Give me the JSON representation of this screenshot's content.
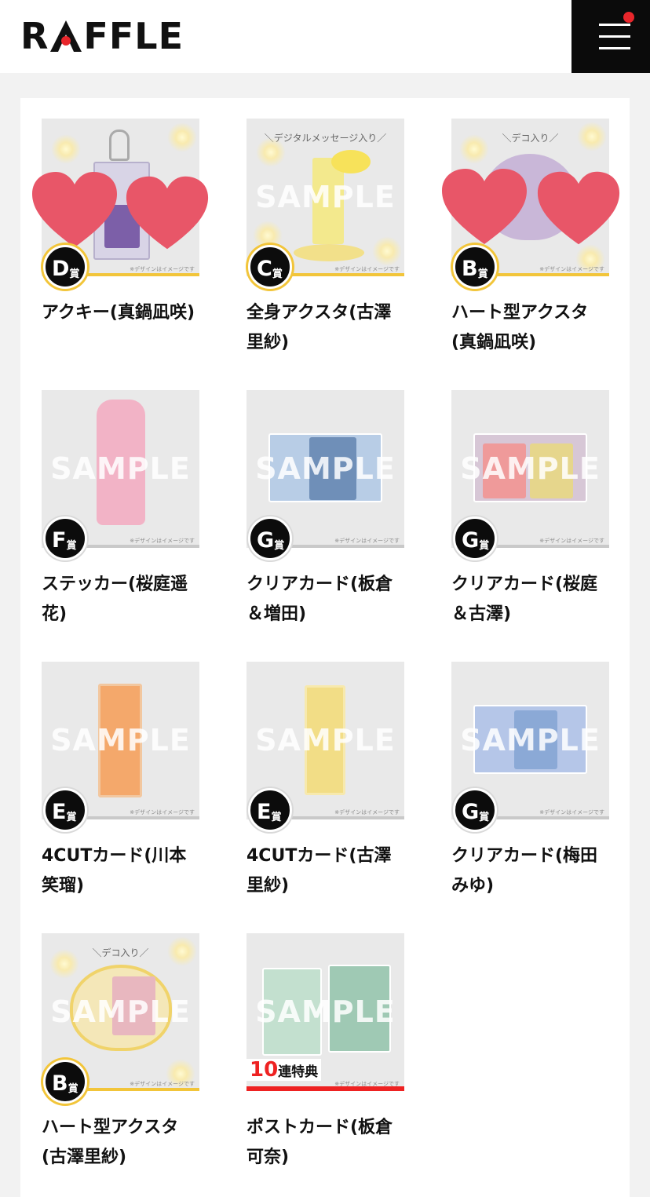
{
  "header": {
    "logo_text_1": "R",
    "logo_text_2": "FFLE",
    "menu_icon": "hamburger-icon"
  },
  "items": [
    {
      "name": "アクキー(真鍋凪咲)",
      "prize": "D",
      "suffix": "賞"
    },
    {
      "name": "全身アクスタ(古澤里紗)",
      "prize": "C",
      "suffix": "賞",
      "tag": "＼デジタルメッセージ入り／"
    },
    {
      "name": "ハート型アクスタ(真鍋凪咲)",
      "prize": "B",
      "suffix": "賞",
      "tag": "＼デコ入り／"
    },
    {
      "name": "ステッカー(桜庭遥花)",
      "prize": "F",
      "suffix": "賞"
    },
    {
      "name": "クリアカード(板倉＆増田)",
      "prize": "G",
      "suffix": "賞"
    },
    {
      "name": "クリアカード(桜庭＆古澤)",
      "prize": "G",
      "suffix": "賞"
    },
    {
      "name": "4CUTカード(川本笑瑠)",
      "prize": "E",
      "suffix": "賞"
    },
    {
      "name": "4CUTカード(古澤里紗)",
      "prize": "E",
      "suffix": "賞"
    },
    {
      "name": "クリアカード(梅田みゆ)",
      "prize": "G",
      "suffix": "賞"
    },
    {
      "name": "ハート型アクスタ(古澤里紗)",
      "prize": "B",
      "suffix": "賞",
      "tag": "＼デコ入り／"
    },
    {
      "name": "ポストカード(板倉可奈)",
      "bonus_number": "10",
      "bonus_text": "連特典"
    }
  ],
  "watermark": "SAMPLE",
  "note": "※デザインはイメージです",
  "colors": {
    "accent_red": "#e22222",
    "gold": "#f2c53a",
    "dark": "#0b0b0b"
  }
}
